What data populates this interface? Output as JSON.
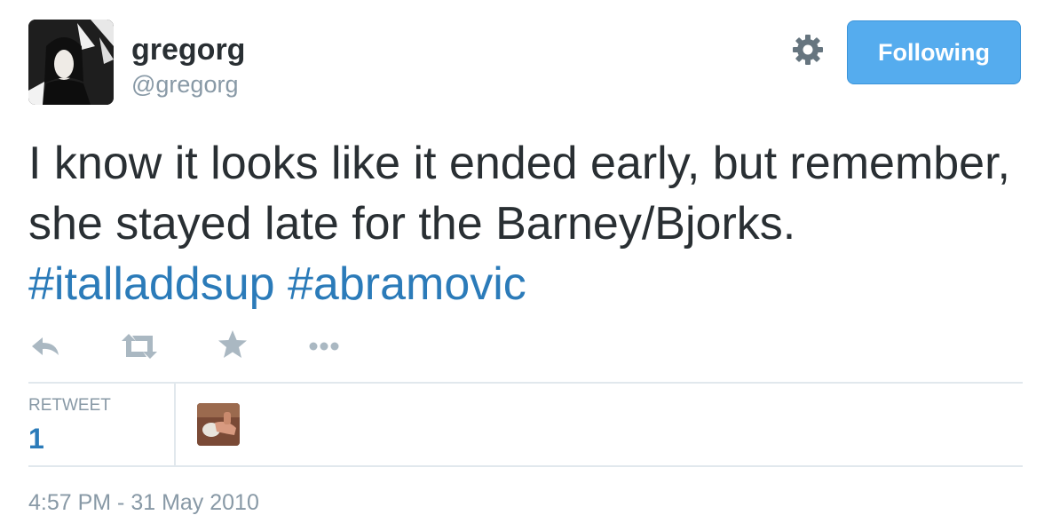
{
  "user": {
    "name": "gregorg",
    "handle": "@gregorg"
  },
  "follow_button": {
    "label": "Following"
  },
  "tweet": {
    "text_plain": "I know it looks like it ended early, but remember, she stayed late for the Barney/Bjorks. ",
    "hashtags": [
      "#italladdsup",
      "#abramovic"
    ]
  },
  "actions": {
    "icons": [
      "reply-icon",
      "retweet-icon",
      "favorite-icon",
      "more-icon"
    ]
  },
  "stats": {
    "retweet_label": "RETWEET",
    "retweet_count": "1"
  },
  "timestamp": "4:57 PM - 31 May 2010",
  "colors": {
    "accent": "#55acee",
    "link": "#2b7bb9",
    "muted": "#8899a6",
    "text": "#292f33"
  }
}
